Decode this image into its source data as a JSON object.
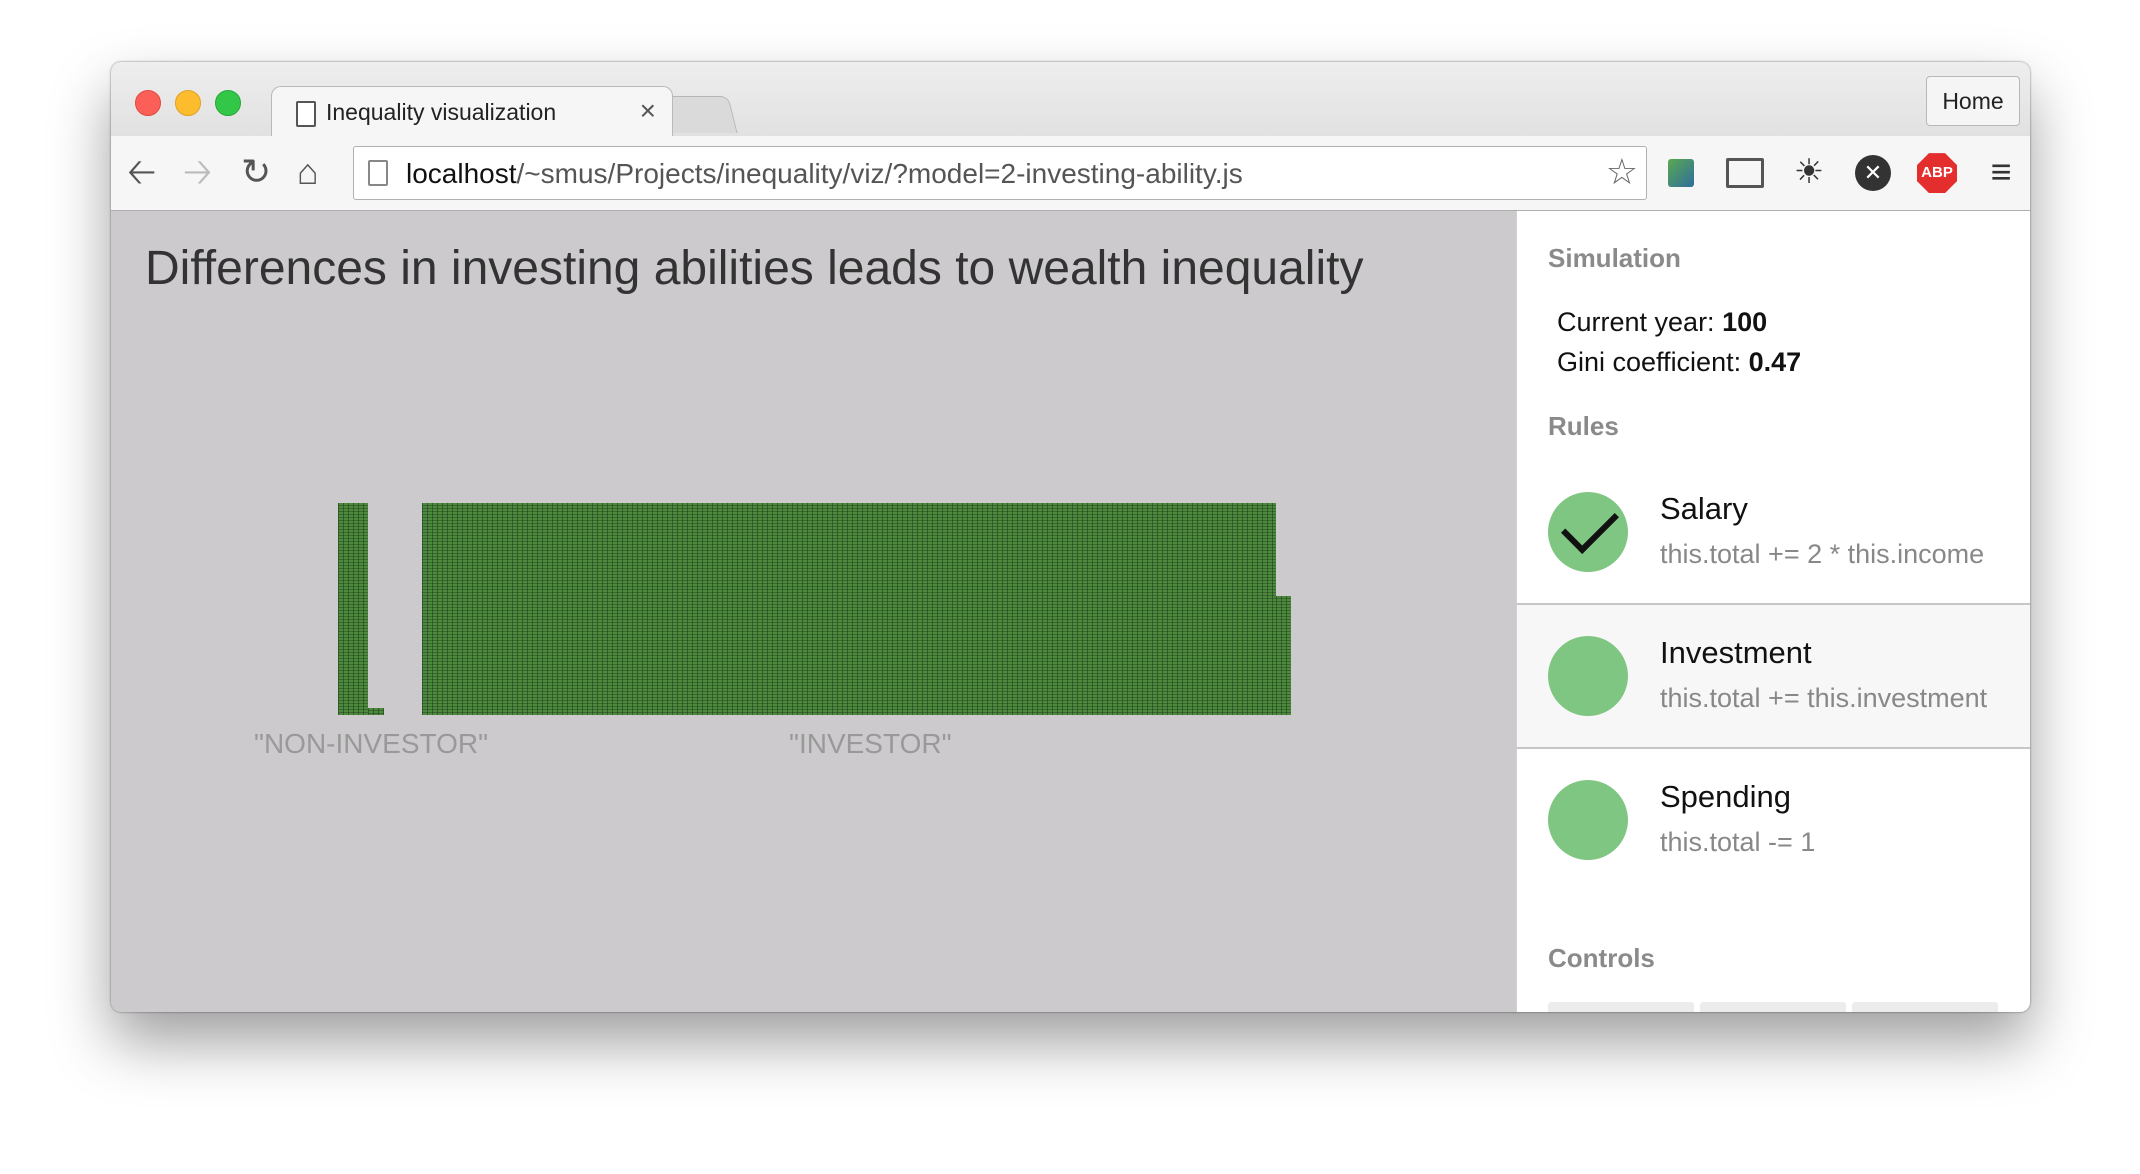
{
  "browser": {
    "tab_title": "Inequality visualization",
    "tab_close": "×",
    "home_button": "Home",
    "url_host": "localhost",
    "url_path": "/~smus/Projects/inequality/viz/?model=2-investing-ability.js",
    "abp_label": "ABP"
  },
  "main": {
    "title": "Differences in investing abilities leads to wealth inequality",
    "groups": [
      {
        "label": "\"NON-INVESTOR\""
      },
      {
        "label": "\"INVESTOR\""
      }
    ]
  },
  "sidebar": {
    "simulation_heading": "Simulation",
    "current_year_label": "Current year: ",
    "current_year": "100",
    "gini_label": "Gini coefficient: ",
    "gini": "0.47",
    "rules_heading": "Rules",
    "rules": [
      {
        "name": "Salary",
        "code": "this.total += 2 * this.income",
        "enabled": true
      },
      {
        "name": "Investment",
        "code": "this.total += this.investment",
        "enabled": false
      },
      {
        "name": "Spending",
        "code": "this.total -= 1",
        "enabled": false
      }
    ],
    "controls_heading": "Controls"
  },
  "colors": {
    "bar_green": "#4d8a3e",
    "rule_circle": "#80c683",
    "main_bg": "#cccacd"
  }
}
